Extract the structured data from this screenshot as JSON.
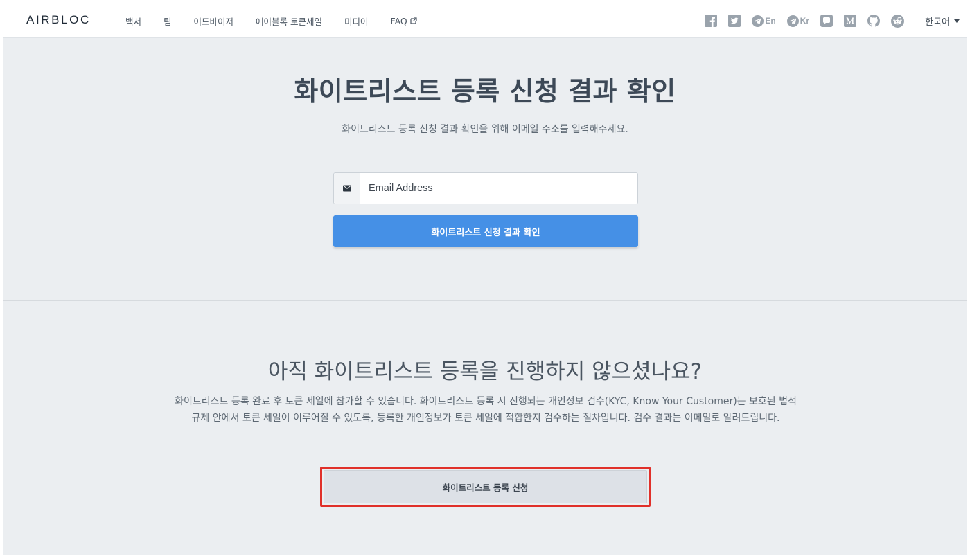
{
  "brand": "AIRBLOC",
  "nav": {
    "items": [
      "백서",
      "팀",
      "어드바이저",
      "에어블록 토큰세일",
      "미디어",
      "FAQ"
    ]
  },
  "socials": {
    "telegram_en": "En",
    "telegram_kr": "Kr"
  },
  "language": "한국어",
  "section1": {
    "title": "화이트리스트 등록 신청 결과 확인",
    "subtitle": "화이트리스트 등록 신청 결과 확인을 위해 이메일 주소를 입력해주세요.",
    "email_placeholder": "Email Address",
    "check_button": "화이트리스트 신청 결과 확인"
  },
  "section2": {
    "title": "아직 화이트리스트 등록을 진행하지 않으셨나요?",
    "description_line1": "화이트리스트 등록 완료 후 토큰 세일에 참가할 수 있습니다. 화이트리스트 등록 시 진행되는 개인정보 검수(KYC, Know Your Customer)는 보호된 법적",
    "description_line2": "규제 안에서 토큰 세일이 이루어질 수 있도록, 등록한 개인정보가 토큰 세일에 적합한지 검수하는 절차입니다. 검수 결과는 이메일로 알려드립니다.",
    "register_button": "화이트리스트 등록 신청"
  },
  "colors": {
    "primary_button": "#4590e6",
    "highlight_border": "#e0302a",
    "background": "#ebeef1"
  }
}
